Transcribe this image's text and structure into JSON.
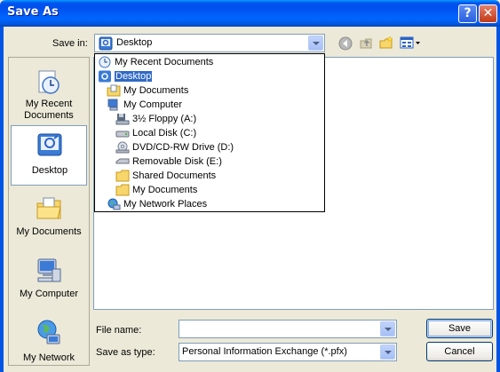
{
  "window": {
    "title": "Save As",
    "help_label": "?",
    "close_label": "✕"
  },
  "toolbar": {
    "save_in_label": "Save in:",
    "save_in_value": "Desktop",
    "back_icon": "back-icon",
    "up_icon": "up-folder-icon",
    "new_folder_icon": "new-folder-icon",
    "views_icon": "views-menu-icon"
  },
  "places": [
    {
      "label": "My Recent Documents",
      "icon": "recent-documents-icon",
      "selected": false
    },
    {
      "label": "Desktop",
      "icon": "desktop-icon",
      "selected": true
    },
    {
      "label": "My Documents",
      "icon": "my-documents-icon",
      "selected": false
    },
    {
      "label": "My Computer",
      "icon": "my-computer-icon",
      "selected": false
    },
    {
      "label": "My Network",
      "icon": "my-network-icon",
      "selected": false
    }
  ],
  "dropdown": {
    "items": [
      {
        "label": "My Recent Documents",
        "icon": "recent-documents-icon"
      },
      {
        "label": "Desktop",
        "icon": "desktop-icon",
        "selected": true
      },
      {
        "label": "My Documents",
        "icon": "my-documents-icon"
      },
      {
        "label": "My Computer",
        "icon": "my-computer-icon"
      },
      {
        "label": "3½ Floppy (A:)",
        "icon": "floppy-drive-icon"
      },
      {
        "label": "Local Disk (C:)",
        "icon": "hard-disk-icon"
      },
      {
        "label": "DVD/CD-RW Drive (D:)",
        "icon": "cd-drive-icon"
      },
      {
        "label": "Removable Disk (E:)",
        "icon": "removable-disk-icon"
      },
      {
        "label": "Shared Documents",
        "icon": "folder-icon"
      },
      {
        "label": "My Documents",
        "icon": "folder-icon"
      },
      {
        "label": "My Network Places",
        "icon": "network-places-icon"
      }
    ]
  },
  "form": {
    "file_name_label": "File name:",
    "file_name_value": "",
    "save_as_type_label": "Save as type:",
    "save_as_type_value": "Personal Information Exchange (*.pfx)"
  },
  "buttons": {
    "save": "Save",
    "cancel": "Cancel"
  },
  "colors": {
    "titlebar": "#0055E5",
    "selection": "#316AC5",
    "dialog_bg": "#ECE9D8"
  }
}
